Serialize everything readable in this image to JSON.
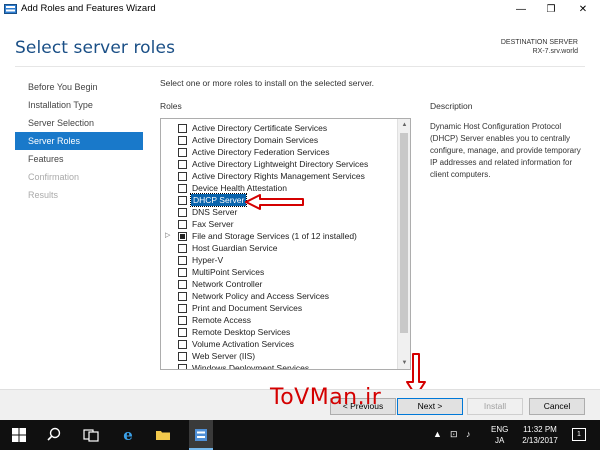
{
  "window": {
    "title": "Add Roles and Features Wizard",
    "minimize": "—",
    "restore": "❐",
    "close": "✕"
  },
  "header": {
    "page_title": "Select server roles",
    "destination_label": "DESTINATION SERVER",
    "destination_value": "RX-7.srv.world"
  },
  "nav": {
    "items": [
      {
        "label": "Before You Begin",
        "state": "normal"
      },
      {
        "label": "Installation Type",
        "state": "normal"
      },
      {
        "label": "Server Selection",
        "state": "normal"
      },
      {
        "label": "Server Roles",
        "state": "active"
      },
      {
        "label": "Features",
        "state": "normal"
      },
      {
        "label": "Confirmation",
        "state": "disabled"
      },
      {
        "label": "Results",
        "state": "disabled"
      }
    ]
  },
  "main": {
    "intro": "Select one or more roles to install on the selected server.",
    "roles_label": "Roles",
    "description_label": "Description",
    "description_text": "Dynamic Host Configuration Protocol (DHCP) Server enables you to centrally configure, manage, and provide temporary IP addresses and related information for client computers.",
    "roles": [
      {
        "name": "Active Directory Certificate Services",
        "checked": false
      },
      {
        "name": "Active Directory Domain Services",
        "checked": false
      },
      {
        "name": "Active Directory Federation Services",
        "checked": false
      },
      {
        "name": "Active Directory Lightweight Directory Services",
        "checked": false
      },
      {
        "name": "Active Directory Rights Management Services",
        "checked": false
      },
      {
        "name": "Device Health Attestation",
        "checked": false
      },
      {
        "name": "DHCP Server",
        "checked": false,
        "selected": true
      },
      {
        "name": "DNS Server",
        "checked": false
      },
      {
        "name": "Fax Server",
        "checked": false
      },
      {
        "name": "File and Storage Services (1 of 12 installed)",
        "checked": "partial",
        "expandable": true
      },
      {
        "name": "Host Guardian Service",
        "checked": false
      },
      {
        "name": "Hyper-V",
        "checked": false
      },
      {
        "name": "MultiPoint Services",
        "checked": false
      },
      {
        "name": "Network Controller",
        "checked": false
      },
      {
        "name": "Network Policy and Access Services",
        "checked": false
      },
      {
        "name": "Print and Document Services",
        "checked": false
      },
      {
        "name": "Remote Access",
        "checked": false
      },
      {
        "name": "Remote Desktop Services",
        "checked": false
      },
      {
        "name": "Volume Activation Services",
        "checked": false
      },
      {
        "name": "Web Server (IIS)",
        "checked": false
      },
      {
        "name": "Windows Deployment Services",
        "checked": false
      }
    ]
  },
  "footer": {
    "previous_label": "< Previous",
    "next_label": "Next >",
    "install_label": "Install",
    "cancel_label": "Cancel",
    "watermark": "ToVMan.ir"
  },
  "taskbar": {
    "lang_line1": "ENG",
    "lang_line2": "JA",
    "time": "11:32 PM",
    "date": "2/13/2017",
    "notifications": "1"
  },
  "colors": {
    "accent": "#1979ca",
    "title_blue": "#1a4f86",
    "annotation_red": "#d40000",
    "taskbar": "#101010"
  }
}
